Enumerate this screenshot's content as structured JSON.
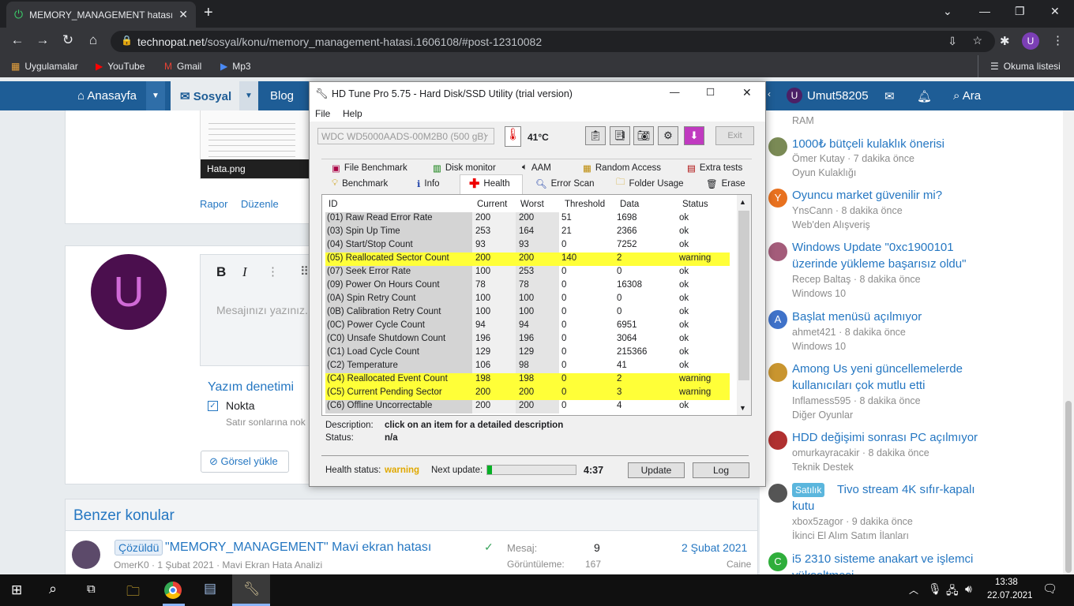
{
  "browser": {
    "tab_title": "MEMORY_MANAGEMENT hatası",
    "url_host": "technopat.net",
    "url_path": "/sosyal/konu/memory_management-hatasi.1606108/#post-12310082",
    "bookmarks": [
      "Uygulamalar",
      "YouTube",
      "Gmail",
      "Mp3"
    ],
    "reading_list": "Okuma listesi",
    "profile_initial": "U"
  },
  "site": {
    "nav": [
      "Anasayfa",
      "Sosyal",
      "Blog"
    ],
    "user": "Umut58205",
    "search": "Ara",
    "attachment_name": "Hata.png",
    "report": "Rapor",
    "edit": "Düzenle",
    "avatar_letter": "U",
    "editor_placeholder": "Mesajınızı yazınız...",
    "spellcheck_title": "Yazım denetimi",
    "spellcheck_option": "Nokta",
    "spellcheck_hint": "Satır sonlarına nok",
    "upload_image": "Görsel yükle",
    "similar_title": "Benzer konular",
    "similar": {
      "badge": "Çözüldü",
      "title": "\"MEMORY_MANAGEMENT\" Mavi ekran hatası",
      "meta": "OmerK0 · 1 Şubat 2021 · Mavi Ekran Hata Analizi",
      "replies_label": "Mesaj:",
      "replies": "9",
      "views_label": "Görüntüleme:",
      "views": "167",
      "date": "2 Şubat 2021",
      "last_user": "Caine"
    },
    "sidebar_top": "RAM",
    "sidebar": [
      {
        "title": "1000₺ bütçeli kulaklık önerisi",
        "meta": "Ömer Kutay · 7 dakika önce",
        "forum": "Oyun Kulaklığı",
        "avatar": "",
        "color": "#7a8a55"
      },
      {
        "title": "Oyuncu market güvenilir mi?",
        "meta": "YnsCann · 8 dakika önce",
        "forum": "Web'den Alışveriş",
        "avatar": "Y",
        "color": "#e8711f"
      },
      {
        "title": "Windows Update \"0xc1900101 üzerinde yükleme başarısız oldu\"",
        "meta": "Recep Baltaş · 8 dakika önce",
        "forum": "Windows 10",
        "avatar": "",
        "color": "#a45c7a"
      },
      {
        "title": "Başlat menüsü açılmıyor",
        "meta": "ahmet421 · 8 dakika önce",
        "forum": "Windows 10",
        "avatar": "A",
        "color": "#3f72c9"
      },
      {
        "title": "Among Us yeni güncellemelerde kullanıcıları çok mutlu etti",
        "meta": "Inflamess595 · 8 dakika önce",
        "forum": "Diğer Oyunlar",
        "avatar": "",
        "color": "#c9952f"
      },
      {
        "title": "HDD değişimi sonrası PC açılmıyor",
        "meta": "omurkayracakir · 8 dakika önce",
        "forum": "Teknik Destek",
        "avatar": "",
        "color": "#b03030"
      },
      {
        "title": "Tivo stream 4K sıfır-kapalı kutu",
        "badge": "Satılık",
        "meta": "xbox5zagor · 9 dakika önce",
        "forum": "İkinci El Alım Satım İlanları",
        "avatar": "",
        "color": "#555"
      },
      {
        "title": "i5 2310 sisteme anakart ve işlemci yükseltmesi",
        "meta": "",
        "forum": "",
        "avatar": "C",
        "color": "#2fae3b"
      }
    ]
  },
  "hdtune": {
    "title": "HD Tune Pro 5.75 - Hard Disk/SSD Utility (trial version)",
    "menu": [
      "File",
      "Help"
    ],
    "drive": "WDC WD5000AADS-00M2B0 (500 gB)",
    "temperature": "41°C",
    "exit": "Exit",
    "tabs_row1": [
      "File Benchmark",
      "Disk monitor",
      "AAM",
      "Random Access",
      "Extra tests"
    ],
    "tabs_row2": [
      "Benchmark",
      "Info",
      "Health",
      "Error Scan",
      "Folder Usage",
      "Erase"
    ],
    "active_tab": "Health",
    "columns": [
      "ID",
      "Current",
      "Worst",
      "Threshold",
      "Data",
      "Status"
    ],
    "rows": [
      {
        "id": "(01) Raw Read Error Rate",
        "cur": "200",
        "worst": "200",
        "thr": "51",
        "data": "1698",
        "status": "ok",
        "warn": false
      },
      {
        "id": "(03) Spin Up Time",
        "cur": "253",
        "worst": "164",
        "thr": "21",
        "data": "2366",
        "status": "ok",
        "warn": false
      },
      {
        "id": "(04) Start/Stop Count",
        "cur": "93",
        "worst": "93",
        "thr": "0",
        "data": "7252",
        "status": "ok",
        "warn": false
      },
      {
        "id": "(05) Reallocated Sector Count",
        "cur": "200",
        "worst": "200",
        "thr": "140",
        "data": "2",
        "status": "warning",
        "warn": true
      },
      {
        "id": "(07) Seek Error Rate",
        "cur": "100",
        "worst": "253",
        "thr": "0",
        "data": "0",
        "status": "ok",
        "warn": false
      },
      {
        "id": "(09) Power On Hours Count",
        "cur": "78",
        "worst": "78",
        "thr": "0",
        "data": "16308",
        "status": "ok",
        "warn": false
      },
      {
        "id": "(0A) Spin Retry Count",
        "cur": "100",
        "worst": "100",
        "thr": "0",
        "data": "0",
        "status": "ok",
        "warn": false
      },
      {
        "id": "(0B) Calibration Retry Count",
        "cur": "100",
        "worst": "100",
        "thr": "0",
        "data": "0",
        "status": "ok",
        "warn": false
      },
      {
        "id": "(0C) Power Cycle Count",
        "cur": "94",
        "worst": "94",
        "thr": "0",
        "data": "6951",
        "status": "ok",
        "warn": false
      },
      {
        "id": "(C0) Unsafe Shutdown Count",
        "cur": "196",
        "worst": "196",
        "thr": "0",
        "data": "3064",
        "status": "ok",
        "warn": false
      },
      {
        "id": "(C1) Load Cycle Count",
        "cur": "129",
        "worst": "129",
        "thr": "0",
        "data": "215366",
        "status": "ok",
        "warn": false
      },
      {
        "id": "(C2) Temperature",
        "cur": "106",
        "worst": "98",
        "thr": "0",
        "data": "41",
        "status": "ok",
        "warn": false
      },
      {
        "id": "(C4) Reallocated Event Count",
        "cur": "198",
        "worst": "198",
        "thr": "0",
        "data": "2",
        "status": "warning",
        "warn": true
      },
      {
        "id": "(C5) Current Pending Sector",
        "cur": "200",
        "worst": "200",
        "thr": "0",
        "data": "3",
        "status": "warning",
        "warn": true
      },
      {
        "id": "(C6) Offline Uncorrectable",
        "cur": "200",
        "worst": "200",
        "thr": "0",
        "data": "4",
        "status": "ok",
        "warn": false
      }
    ],
    "desc_label": "Description:",
    "desc_value": "click on an item for a detailed description",
    "status_label": "Status:",
    "status_value": "n/a",
    "health_label": "Health status:",
    "health_value": "warning",
    "next_label": "Next update:",
    "next_time": "4:37",
    "next_progress": 0.05,
    "update": "Update",
    "log": "Log"
  },
  "taskbar": {
    "time": "13:38",
    "date": "22.07.2021"
  }
}
